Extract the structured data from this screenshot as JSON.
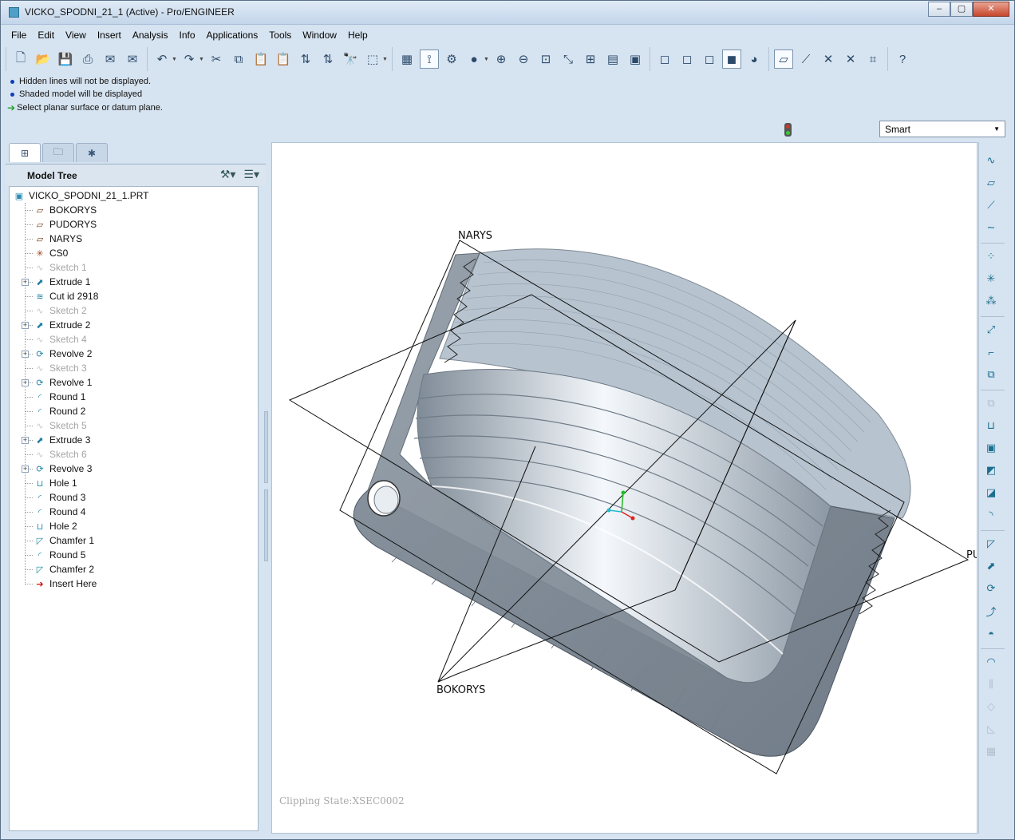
{
  "window": {
    "title": "VICKO_SPODNI_21_1 (Active) - Pro/ENGINEER",
    "controls": {
      "minimize": "–",
      "maximize": "▢",
      "close": "✕"
    }
  },
  "menu": [
    "File",
    "Edit",
    "View",
    "Insert",
    "Analysis",
    "Info",
    "Applications",
    "Tools",
    "Window",
    "Help"
  ],
  "toolbar": {
    "groups": [
      [
        {
          "name": "new-file-icon",
          "glyph": "🗋"
        },
        {
          "name": "open-file-icon",
          "glyph": "📂"
        },
        {
          "name": "save-icon",
          "glyph": "💾"
        },
        {
          "name": "print-icon",
          "glyph": "⎙"
        },
        {
          "name": "email-icon",
          "glyph": "✉"
        },
        {
          "name": "email-link-icon",
          "glyph": "✉"
        }
      ],
      [
        {
          "name": "undo-icon",
          "glyph": "↶",
          "dropdown": true
        },
        {
          "name": "redo-icon",
          "glyph": "↷",
          "dropdown": true
        },
        {
          "name": "cut-icon",
          "glyph": "✂"
        },
        {
          "name": "copy-icon",
          "glyph": "⧉"
        },
        {
          "name": "paste-icon",
          "glyph": "📋"
        },
        {
          "name": "paste-special-icon",
          "glyph": "📋"
        },
        {
          "name": "regenerate-icon",
          "glyph": "⇅"
        },
        {
          "name": "regenerate-manager-icon",
          "glyph": "⇅"
        },
        {
          "name": "find-icon",
          "glyph": "🔭"
        },
        {
          "name": "selection-box-icon",
          "glyph": "⬚",
          "dropdown": true
        }
      ],
      [
        {
          "name": "repaint-icon",
          "glyph": "▦"
        },
        {
          "name": "spin-center-icon",
          "glyph": "⟟",
          "active": true
        },
        {
          "name": "orient-mode-icon",
          "glyph": "⚙"
        },
        {
          "name": "appearance-icon",
          "glyph": "●",
          "dropdown": true
        },
        {
          "name": "zoom-in-icon",
          "glyph": "⊕"
        },
        {
          "name": "zoom-out-icon",
          "glyph": "⊖"
        },
        {
          "name": "refit-icon",
          "glyph": "⊡"
        },
        {
          "name": "reorient-icon",
          "glyph": "⤡"
        },
        {
          "name": "saved-views-icon",
          "glyph": "⊞"
        },
        {
          "name": "layers-icon",
          "glyph": "▤"
        },
        {
          "name": "view-manager-icon",
          "glyph": "▣"
        }
      ],
      [
        {
          "name": "wireframe-icon",
          "glyph": "◻"
        },
        {
          "name": "hidden-line-icon",
          "glyph": "◻"
        },
        {
          "name": "no-hidden-icon",
          "glyph": "◻"
        },
        {
          "name": "shading-icon",
          "glyph": "◼",
          "active": true
        },
        {
          "name": "enhanced-realism-icon",
          "glyph": "◕"
        }
      ],
      [
        {
          "name": "datum-planes-icon",
          "glyph": "▱",
          "active": true
        },
        {
          "name": "datum-axes-icon",
          "glyph": "⟋"
        },
        {
          "name": "datum-points-icon",
          "glyph": "✕"
        },
        {
          "name": "coordinate-systems-icon",
          "glyph": "✕"
        },
        {
          "name": "annotation-display-icon",
          "glyph": "⌗"
        }
      ],
      [
        {
          "name": "context-help-icon",
          "glyph": "?"
        }
      ]
    ]
  },
  "messages": [
    {
      "type": "info",
      "text": "Hidden lines will not be displayed."
    },
    {
      "type": "info",
      "text": "Shaded model will be displayed"
    },
    {
      "type": "prompt",
      "text": "Select planar surface or datum plane."
    }
  ],
  "filter": {
    "value": "Smart"
  },
  "model_tree": {
    "title": "Model Tree",
    "root": "VICKO_SPODNI_21_1.PRT",
    "items": [
      {
        "label": "BOKORYS",
        "icon": "datum-plane-icon",
        "glyph": "▱",
        "expandable": false,
        "suppressed": false
      },
      {
        "label": "PUDORYS",
        "icon": "datum-plane-icon",
        "glyph": "▱",
        "expandable": false,
        "suppressed": false
      },
      {
        "label": "NARYS",
        "icon": "datum-plane-icon",
        "glyph": "▱",
        "expandable": false,
        "suppressed": false
      },
      {
        "label": "CS0",
        "icon": "coordinate-system-icon",
        "glyph": "✳",
        "expandable": false,
        "suppressed": false
      },
      {
        "label": "Sketch 1",
        "icon": "sketch-icon",
        "glyph": "∿",
        "expandable": false,
        "suppressed": true
      },
      {
        "label": "Extrude 1",
        "icon": "extrude-icon",
        "glyph": "⬈",
        "expandable": true,
        "suppressed": false
      },
      {
        "label": "Cut id 2918",
        "icon": "helical-cut-icon",
        "glyph": "≋",
        "expandable": false,
        "suppressed": false
      },
      {
        "label": "Sketch 2",
        "icon": "sketch-icon",
        "glyph": "∿",
        "expandable": false,
        "suppressed": true
      },
      {
        "label": "Extrude 2",
        "icon": "extrude-icon",
        "glyph": "⬈",
        "expandable": true,
        "suppressed": false
      },
      {
        "label": "Sketch 4",
        "icon": "sketch-icon",
        "glyph": "∿",
        "expandable": false,
        "suppressed": true
      },
      {
        "label": "Revolve 2",
        "icon": "revolve-icon",
        "glyph": "⟳",
        "expandable": true,
        "suppressed": false
      },
      {
        "label": "Sketch 3",
        "icon": "sketch-icon",
        "glyph": "∿",
        "expandable": false,
        "suppressed": true
      },
      {
        "label": "Revolve 1",
        "icon": "revolve-icon",
        "glyph": "⟳",
        "expandable": true,
        "suppressed": false
      },
      {
        "label": "Round 1",
        "icon": "round-icon",
        "glyph": "◜",
        "expandable": false,
        "suppressed": false
      },
      {
        "label": "Round 2",
        "icon": "round-icon",
        "glyph": "◜",
        "expandable": false,
        "suppressed": false
      },
      {
        "label": "Sketch 5",
        "icon": "sketch-icon",
        "glyph": "∿",
        "expandable": false,
        "suppressed": true
      },
      {
        "label": "Extrude 3",
        "icon": "extrude-icon",
        "glyph": "⬈",
        "expandable": true,
        "suppressed": false
      },
      {
        "label": "Sketch 6",
        "icon": "sketch-icon",
        "glyph": "∿",
        "expandable": false,
        "suppressed": true
      },
      {
        "label": "Revolve 3",
        "icon": "revolve-icon",
        "glyph": "⟳",
        "expandable": true,
        "suppressed": false
      },
      {
        "label": "Hole 1",
        "icon": "hole-icon",
        "glyph": "⊔",
        "expandable": false,
        "suppressed": false
      },
      {
        "label": "Round 3",
        "icon": "round-icon",
        "glyph": "◜",
        "expandable": false,
        "suppressed": false
      },
      {
        "label": "Round 4",
        "icon": "round-icon",
        "glyph": "◜",
        "expandable": false,
        "suppressed": false
      },
      {
        "label": "Hole 2",
        "icon": "hole-icon",
        "glyph": "⊔",
        "expandable": false,
        "suppressed": false
      },
      {
        "label": "Chamfer 1",
        "icon": "chamfer-icon",
        "glyph": "◸",
        "expandable": false,
        "suppressed": false
      },
      {
        "label": "Round 5",
        "icon": "round-icon",
        "glyph": "◜",
        "expandable": false,
        "suppressed": false
      },
      {
        "label": "Chamfer 2",
        "icon": "chamfer-icon",
        "glyph": "◸",
        "expandable": false,
        "suppressed": false
      },
      {
        "label": "Insert Here",
        "icon": "insert-here-icon",
        "glyph": "➔",
        "expandable": false,
        "suppressed": false
      }
    ]
  },
  "viewport": {
    "clipping_state": "Clipping State:XSEC0002",
    "datum_labels": {
      "narys": "NARYS",
      "bokorys": "BOKORYS",
      "pudorys": "PU"
    }
  },
  "right_toolbar": [
    {
      "name": "sketched-datum-curve-icon",
      "glyph": "∿",
      "enabled": true
    },
    {
      "name": "datum-plane-tool-icon",
      "glyph": "▱",
      "enabled": true
    },
    {
      "name": "datum-axis-tool-icon",
      "glyph": "⟋",
      "enabled": true
    },
    {
      "name": "datum-curve-tool-icon",
      "glyph": "∼",
      "enabled": true
    },
    {
      "name": "datum-point-tool-icon",
      "glyph": "⁘",
      "enabled": true
    },
    {
      "name": "coordinate-system-tool-icon",
      "glyph": "✳",
      "enabled": true
    },
    {
      "name": "analysis-feature-icon",
      "glyph": "⁂",
      "enabled": true
    },
    {
      "name": "offset-tool-icon",
      "glyph": "⤢",
      "enabled": true
    },
    {
      "name": "insert-ref-icon",
      "glyph": "⌐",
      "enabled": true
    },
    {
      "name": "copy-geom-icon",
      "glyph": "⧉",
      "enabled": true
    },
    {
      "name": "publish-geom-icon",
      "glyph": "⧉",
      "enabled": false
    },
    {
      "name": "hole-tool-icon",
      "glyph": "⊔",
      "enabled": true
    },
    {
      "name": "shell-tool-icon",
      "glyph": "▣",
      "enabled": true
    },
    {
      "name": "rib-tool-icon",
      "glyph": "◩",
      "enabled": true
    },
    {
      "name": "draft-tool-icon",
      "glyph": "◪",
      "enabled": true
    },
    {
      "name": "round-tool-icon",
      "glyph": "◝",
      "enabled": true
    },
    {
      "name": "chamfer-tool-icon",
      "glyph": "◸",
      "enabled": true
    },
    {
      "name": "extrude-tool-icon",
      "glyph": "⬈",
      "enabled": true
    },
    {
      "name": "revolve-tool-icon",
      "glyph": "⟳",
      "enabled": true
    },
    {
      "name": "sweep-tool-icon",
      "glyph": "⤴",
      "enabled": true
    },
    {
      "name": "blend-tool-icon",
      "glyph": "◓",
      "enabled": true
    },
    {
      "name": "boundary-blend-icon",
      "glyph": "◠",
      "enabled": true
    },
    {
      "name": "mirror-tool-icon",
      "glyph": "⫼",
      "enabled": false
    },
    {
      "name": "merge-tool-icon",
      "glyph": "◇",
      "enabled": false
    },
    {
      "name": "trim-tool-icon",
      "glyph": "◺",
      "enabled": false
    },
    {
      "name": "pattern-tool-icon",
      "glyph": "▦",
      "enabled": false
    }
  ]
}
